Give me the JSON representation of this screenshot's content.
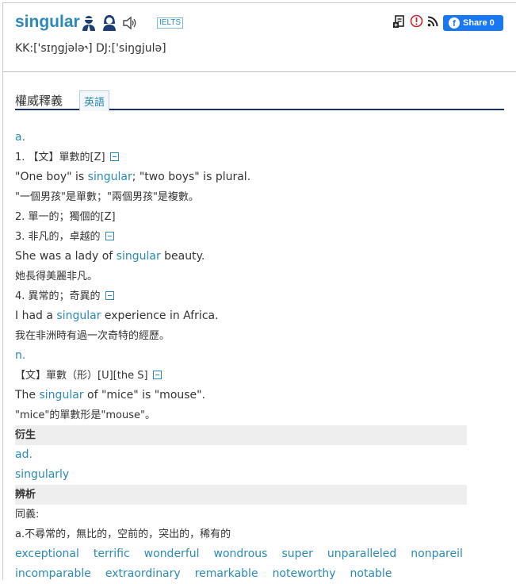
{
  "header": {
    "word": "singular",
    "exam_tag": "IELTS",
    "phonetic": "KK:['sɪŋgjələ˞] DJ:['siŋgjulə]",
    "share_label": "Share 0",
    "facebook_glyph": "f",
    "icons": [
      "male-voice-icon",
      "female-voice-icon",
      "speaker-icon",
      "add-wordbook-icon",
      "report-icon",
      "rss-icon",
      "facebook-icon"
    ]
  },
  "tabs": {
    "active": "權威釋義",
    "other": "英語"
  },
  "entries": {
    "pos_adj": "a.",
    "def1": "1. 【文】單數的[Z]",
    "ex1_a": "\"One boy\" is ",
    "ex1_w": "singular",
    "ex1_b": "; \"two boys\" is plural.",
    "tr1": "\"一個男孩\"是單數；\"兩個男孩\"是複數。",
    "def2": "2. 單一的；獨個的[Z]",
    "def3": "3. 非凡的，卓越的",
    "ex3_a": "She was a lady of ",
    "ex3_w": "singular",
    "ex3_b": " beauty.",
    "tr3": "她長得美麗非凡。",
    "def4": "4. 異常的；奇異的",
    "ex4_a": "I had a ",
    "ex4_w": "singular",
    "ex4_b": " experience in Africa.",
    "tr4": "我在非洲時有過一次奇特的經歷。",
    "pos_noun": "n.",
    "def5": "【文】單數（形）[U][the S]",
    "ex5_a": "The ",
    "ex5_w": "singular",
    "ex5_b": " of \"mice\" is \"mouse\".",
    "tr5": "\"mice\"的單數形是\"mouse\"。"
  },
  "derivatives": {
    "heading": "衍生",
    "pos": "ad.",
    "word": "singularly"
  },
  "analysis": {
    "heading": "辨析",
    "synonyms_label": "同義:",
    "sense": "a.不尋常的，無比的，空前的，突出的，稀有的",
    "synonyms_row1": [
      "exceptional",
      "terrific",
      "wonderful",
      "wondrous",
      "super",
      "unparalleled",
      "nonpareil"
    ],
    "synonyms_row2": [
      "incomparable",
      "extraordinary",
      "remarkable",
      "noteworthy",
      "notable"
    ]
  },
  "colors": {
    "link": "#2a8ab5",
    "tab_rule": "#1a2e6e",
    "section_bg": "#eeeeee",
    "facebook": "#1877f2"
  }
}
